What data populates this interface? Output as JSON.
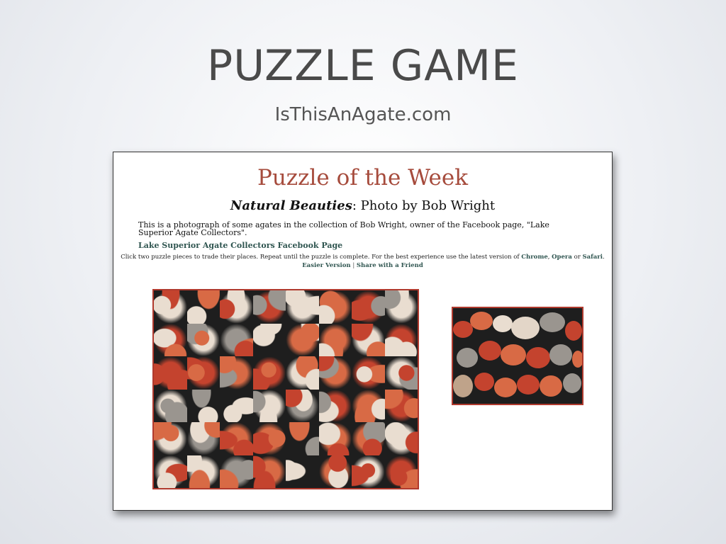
{
  "slide": {
    "title": "PUZZLE GAME",
    "subtitle": "IsThisAnAgate.com"
  },
  "page": {
    "heading": "Puzzle of the Week",
    "photo_title": "Natural Beauties",
    "photo_credit": ": Photo by Bob Wright",
    "description": "This is a photograph of some agates in the collection of Bob Wright, owner of the Facebook page, \"Lake Superior Agate Collectors\".",
    "facebook_link": "Lake Superior Agate Collectors Facebook Page",
    "instructions_prefix": "Click two puzzle pieces to trade their places. Repeat until the puzzle is complete. For the best experience use the latest version of ",
    "browser_chrome": "Chrome",
    "comma": ", ",
    "browser_opera": "Opera",
    "or_text": " or ",
    "browser_safari": "Safari",
    "period": ".",
    "easier_version": "Easier Version",
    "separator": " | ",
    "share": "Share with a Friend"
  },
  "puzzle": {
    "columns": 8,
    "rows": 6,
    "colors": {
      "agate_red": "#c4432e",
      "agate_orange": "#d86a45",
      "agate_cream": "#e9ddd0",
      "agate_grey": "#9a958f",
      "background": "#1e1e1e",
      "border": "#b03a2e"
    }
  }
}
